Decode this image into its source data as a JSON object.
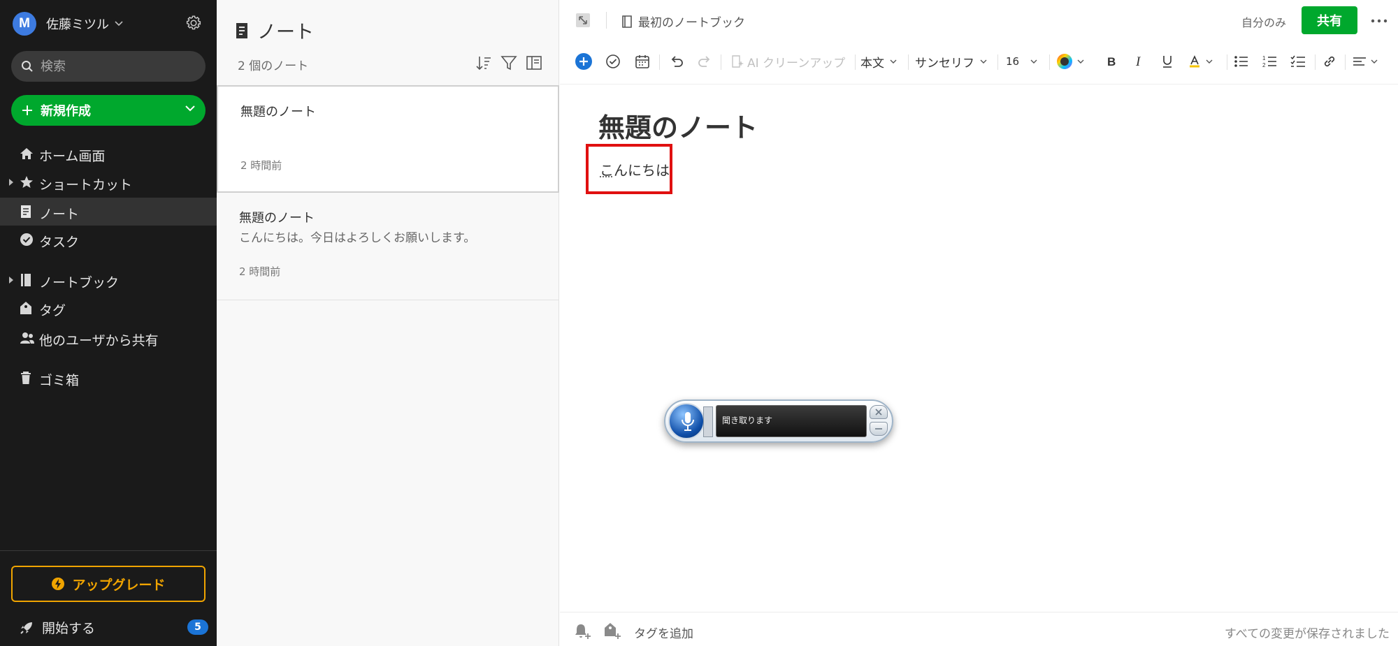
{
  "sidebar": {
    "avatar_letter": "M",
    "account_name": "佐藤ミツル",
    "search_placeholder": "検索",
    "new_button": "新規作成",
    "nav": {
      "home": "ホーム画面",
      "shortcuts": "ショートカット",
      "notes": "ノート",
      "tasks": "タスク",
      "notebooks": "ノートブック",
      "tags": "タグ",
      "shared": "他のユーザから共有",
      "trash": "ゴミ箱"
    },
    "active_item": "notes",
    "upgrade": "アップグレード",
    "getting_started": "開始する",
    "getting_started_badge": "5"
  },
  "notelist": {
    "title": "ノート",
    "count": "2 個のノート",
    "notes": [
      {
        "title": "無題のノート",
        "snippet": "",
        "time": "2 時間前",
        "selected": true
      },
      {
        "title": "無題のノート",
        "snippet": "こんにちは。今日はよろしくお願いします。",
        "time": "2 時間前",
        "selected": false
      }
    ]
  },
  "editor": {
    "notebook": "最初のノートブック",
    "visibility": "自分のみ",
    "share_button": "共有",
    "toolbar": {
      "ai_cleanup": "AI クリーンアップ",
      "paragraph_style": "本文",
      "font_family": "サンセリフ",
      "font_size": "16"
    },
    "note_title": "無題のノート",
    "note_body": "こんにちは",
    "add_tag": "タグを追加",
    "save_status": "すべての変更が保存されました"
  },
  "speech_widget": {
    "status": "聞き取ります"
  },
  "colors": {
    "green": "#00a82d",
    "sidebar_bg": "#1a1a1a",
    "upgrade": "#f0a400",
    "highlight": "#e01010",
    "badge": "#1b74d6"
  }
}
